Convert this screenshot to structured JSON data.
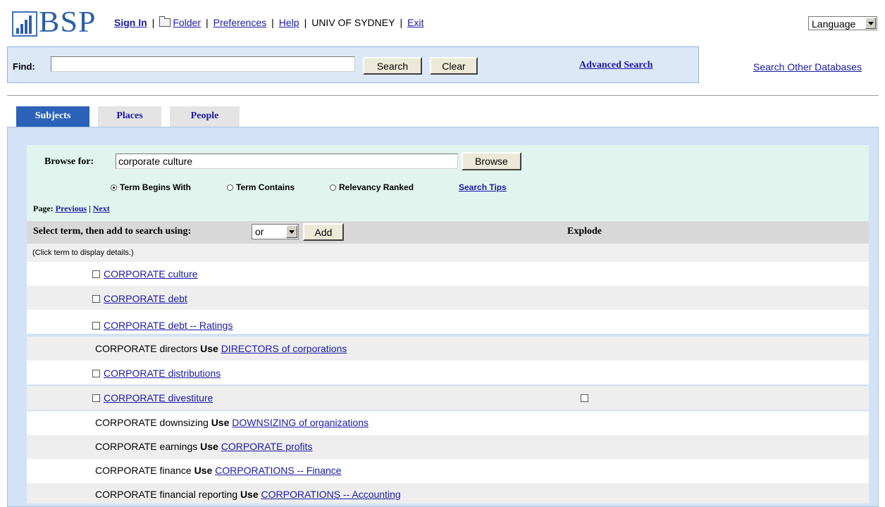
{
  "header": {
    "logo_text": "BSP",
    "nav": {
      "sign_in": "Sign In",
      "folder": "Folder",
      "preferences": "Preferences",
      "help": "Help",
      "institution": "UNIV OF SYDNEY",
      "exit": "Exit",
      "separator": "|"
    },
    "language_select": "Language"
  },
  "find": {
    "label": "Find:",
    "value": "",
    "search_button": "Search",
    "clear_button": "Clear",
    "advanced_search": "Advanced Search",
    "other_databases": "Search Other Databases"
  },
  "tabs": [
    {
      "label": "Subjects",
      "active": true
    },
    {
      "label": "Places",
      "active": false
    },
    {
      "label": "People",
      "active": false
    }
  ],
  "browse": {
    "label": "Browse for:",
    "value": "corporate culture",
    "button": "Browse",
    "options": [
      {
        "label": "Term Begins With",
        "selected": true
      },
      {
        "label": "Term Contains",
        "selected": false
      },
      {
        "label": "Relevancy Ranked",
        "selected": false
      }
    ],
    "search_tips": "Search Tips"
  },
  "paging": {
    "label": "Page:",
    "previous": "Previous",
    "next": "Next",
    "separator": "|"
  },
  "select_bar": {
    "label": "Select term, then add to search using:",
    "operator": "or",
    "add_button": "Add",
    "explode_header": "Explode"
  },
  "note": "(Click term to display details.)",
  "terms": [
    {
      "type": "term",
      "label": "CORPORATE culture",
      "explode": false
    },
    {
      "type": "term",
      "label": "CORPORATE debt",
      "explode": false
    },
    {
      "type": "term",
      "label": "CORPORATE debt -- Ratings",
      "explode": false
    },
    {
      "type": "use",
      "prefix": "CORPORATE directors",
      "use_word": "Use",
      "link": "DIRECTORS of corporations"
    },
    {
      "type": "term",
      "label": "CORPORATE distributions",
      "explode": false
    },
    {
      "type": "term",
      "label": "CORPORATE divestiture",
      "explode": true
    },
    {
      "type": "use",
      "prefix": "CORPORATE downsizing",
      "use_word": "Use",
      "link": "DOWNSIZING of organizations"
    },
    {
      "type": "use",
      "prefix": "CORPORATE earnings",
      "use_word": "Use",
      "link": "CORPORATE profits"
    },
    {
      "type": "use",
      "prefix": "CORPORATE finance",
      "use_word": "Use",
      "link": "CORPORATIONS -- Finance"
    },
    {
      "type": "use",
      "prefix": "CORPORATE financial reporting",
      "use_word": "Use",
      "link": "CORPORATIONS -- Accounting"
    }
  ],
  "colors": {
    "brand": "#2d5fa8",
    "active_tab": "#2c62b8",
    "link": "#1a1aa6",
    "browse_area": "#e1f4ee",
    "panel": "#d3e2f6"
  }
}
